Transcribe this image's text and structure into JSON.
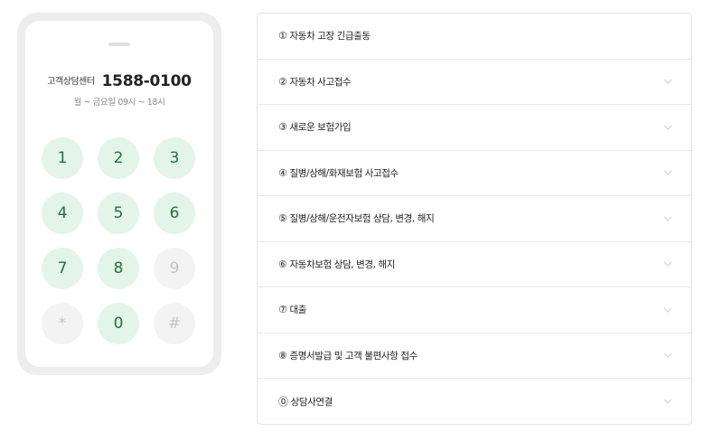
{
  "phone": {
    "center_label": "고객상담센터",
    "center_number": "1588-0100",
    "hours": "월 ~ 금요일 09시 ~ 18시",
    "keys": [
      {
        "label": "1",
        "enabled": true
      },
      {
        "label": "2",
        "enabled": true
      },
      {
        "label": "3",
        "enabled": true
      },
      {
        "label": "4",
        "enabled": true
      },
      {
        "label": "5",
        "enabled": true
      },
      {
        "label": "6",
        "enabled": true
      },
      {
        "label": "7",
        "enabled": true
      },
      {
        "label": "8",
        "enabled": true
      },
      {
        "label": "9",
        "enabled": false
      },
      {
        "label": "*",
        "enabled": false
      },
      {
        "label": "0",
        "enabled": true
      },
      {
        "label": "#",
        "enabled": false
      }
    ]
  },
  "menu": {
    "items": [
      {
        "num": "①",
        "label": "자동차 고장 긴급출동",
        "chevron": false
      },
      {
        "num": "②",
        "label": "자동차 사고접수",
        "chevron": true
      },
      {
        "num": "③",
        "label": "새로운 보험가입",
        "chevron": true
      },
      {
        "num": "④",
        "label": "질병/상해/화재보험 사고접수",
        "chevron": true
      },
      {
        "num": "⑤",
        "label": "질병/상해/운전자보험 상담, 변경, 해지",
        "chevron": true
      },
      {
        "num": "⑥",
        "label": "자동차보험 상담, 변경, 해지",
        "chevron": true
      },
      {
        "num": "⑦",
        "label": "대출",
        "chevron": true
      },
      {
        "num": "⑧",
        "label": "증명서발급 및 고객 불편사항 접수",
        "chevron": true
      },
      {
        "num": "⓪",
        "label": "상담사연결",
        "chevron": true
      }
    ]
  },
  "colors": {
    "key_active_bg": "#e3f4e8",
    "key_active_text": "#2c6b3f",
    "key_inactive_bg": "#f3f3f3",
    "key_inactive_text": "#c4c4c4"
  }
}
